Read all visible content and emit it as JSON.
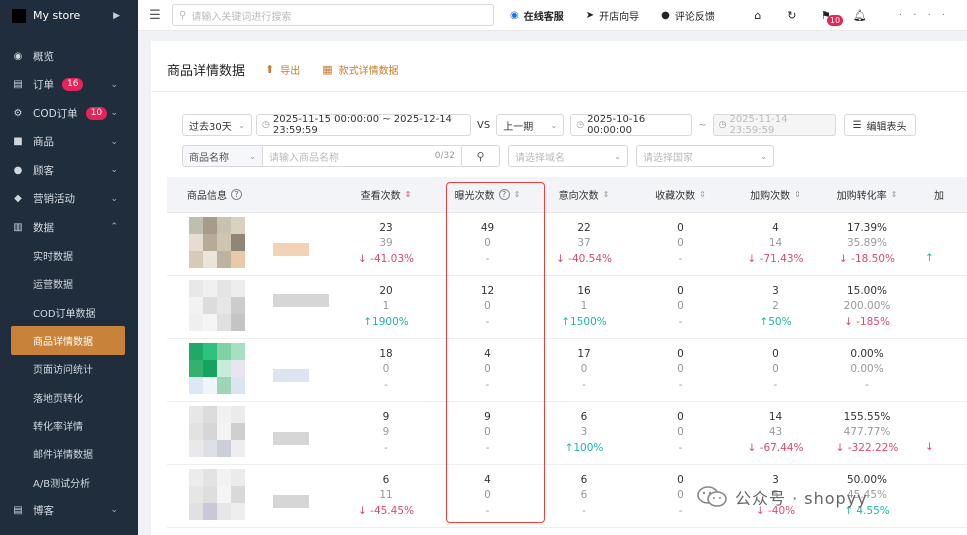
{
  "sidebar": {
    "brand": "My store",
    "items": [
      {
        "label": "概览",
        "icon": "dashboard-icon",
        "char": "◉"
      },
      {
        "label": "订单",
        "icon": "order-icon",
        "char": "▤",
        "badge": "16",
        "caret": "⌄"
      },
      {
        "label": "COD订单",
        "icon": "cod-icon",
        "char": "⚙",
        "badge": "10",
        "caret": "⌄"
      },
      {
        "label": "商品",
        "icon": "product-icon",
        "char": "■",
        "caret": "⌄"
      },
      {
        "label": "顾客",
        "icon": "customer-icon",
        "char": "●",
        "caret": "⌄"
      },
      {
        "label": "营销活动",
        "icon": "tag-icon",
        "char": "◆",
        "caret": "⌄"
      },
      {
        "label": "数据",
        "icon": "chart-icon",
        "char": "▥",
        "caret": "⌃"
      }
    ],
    "sub_items": [
      "实时数据",
      "运营数据",
      "COD订单数据",
      "商品详情数据",
      "页面访问统计",
      "落地页转化",
      "转化率详情",
      "邮件详情数据",
      "A/B测试分析"
    ],
    "bottom_item": {
      "label": "博客",
      "icon": "blog-icon",
      "char": "▤",
      "caret": "⌄"
    }
  },
  "topbar": {
    "search_placeholder": "请输入关键词进行搜索",
    "nav": [
      {
        "label": "在线客服",
        "icon": "support-icon",
        "char": "◉"
      },
      {
        "label": "开店向导",
        "icon": "send-icon",
        "char": "➤"
      },
      {
        "label": "评论反馈",
        "icon": "comment-icon",
        "char": "●"
      }
    ],
    "flag_badge": "10",
    "user_name": "· · · ·"
  },
  "page": {
    "title": "商品详情数据",
    "export_label": "导出",
    "style_label": "款式详情数据"
  },
  "filters": {
    "period": "过去30天",
    "date_range": "2025-11-15 00:00:00 ~ 2025-12-14 23:59:59",
    "vs": "VS",
    "compare": "上一期",
    "cmp_start": "2025-10-16 00:00:00",
    "tilde": "~",
    "cmp_end": "2025-11-14 23:59:59",
    "edit_header": "编辑表头",
    "name_type": "商品名称",
    "name_placeholder": "请输入商品名称",
    "name_count": "0/32",
    "domain_placeholder": "请选择域名",
    "country_placeholder": "请选择国家"
  },
  "table": {
    "headers": [
      "商品信息",
      "查看次数",
      "曝光次数",
      "意向次数",
      "收藏次数",
      "加购次数",
      "加购转化率",
      "加"
    ],
    "rows": [
      {
        "cols": [
          [
            "23",
            "39",
            "↓ -41.03%",
            "down"
          ],
          [
            "49",
            "0",
            "-",
            "none"
          ],
          [
            "22",
            "37",
            "↓ -40.54%",
            "down"
          ],
          [
            "0",
            "0",
            "-",
            "none"
          ],
          [
            "4",
            "14",
            "↓ -71.43%",
            "down"
          ],
          [
            "17.39%",
            "35.89%",
            "↓ -18.50%",
            "down"
          ]
        ],
        "extra": "↑"
      },
      {
        "cols": [
          [
            "20",
            "1",
            "↑1900%",
            "up"
          ],
          [
            "12",
            "0",
            "-",
            "none"
          ],
          [
            "16",
            "1",
            "↑1500%",
            "up"
          ],
          [
            "0",
            "0",
            "-",
            "none"
          ],
          [
            "3",
            "2",
            "↑50%",
            "up"
          ],
          [
            "15.00%",
            "200.00%",
            "↓ -185%",
            "down"
          ]
        ],
        "extra": ""
      },
      {
        "cols": [
          [
            "18",
            "0",
            "-",
            "none"
          ],
          [
            "4",
            "0",
            "-",
            "none"
          ],
          [
            "17",
            "0",
            "-",
            "none"
          ],
          [
            "0",
            "0",
            "-",
            "none"
          ],
          [
            "0",
            "0",
            "-",
            "none"
          ],
          [
            "0.00%",
            "0.00%",
            "-",
            "none"
          ]
        ],
        "extra": ""
      },
      {
        "cols": [
          [
            "9",
            "9",
            "-",
            "none"
          ],
          [
            "9",
            "0",
            "-",
            "none"
          ],
          [
            "6",
            "3",
            "↑100%",
            "up"
          ],
          [
            "0",
            "0",
            "-",
            "none"
          ],
          [
            "14",
            "43",
            "↓ -67.44%",
            "down"
          ],
          [
            "155.55%",
            "477.77%",
            "↓ -322.22%",
            "down"
          ]
        ],
        "extra": "↓"
      },
      {
        "cols": [
          [
            "6",
            "11",
            "↓ -45.45%",
            "down"
          ],
          [
            "4",
            "0",
            "-",
            "none"
          ],
          [
            "6",
            "6",
            "-",
            "none"
          ],
          [
            "0",
            "0",
            "-",
            "none"
          ],
          [
            "3",
            "5",
            "↓ -40%",
            "down"
          ],
          [
            "50.00%",
            "45.45%",
            "↑ 4.55%",
            "up"
          ]
        ],
        "extra": ""
      }
    ]
  },
  "watermark": "公众号 · shopyy",
  "colors": {
    "accent": "#c8823a",
    "down": "#e04a6a",
    "up": "#1fb5a8",
    "highlight": "#e8403a",
    "sidebar": "#1f2d3d"
  }
}
